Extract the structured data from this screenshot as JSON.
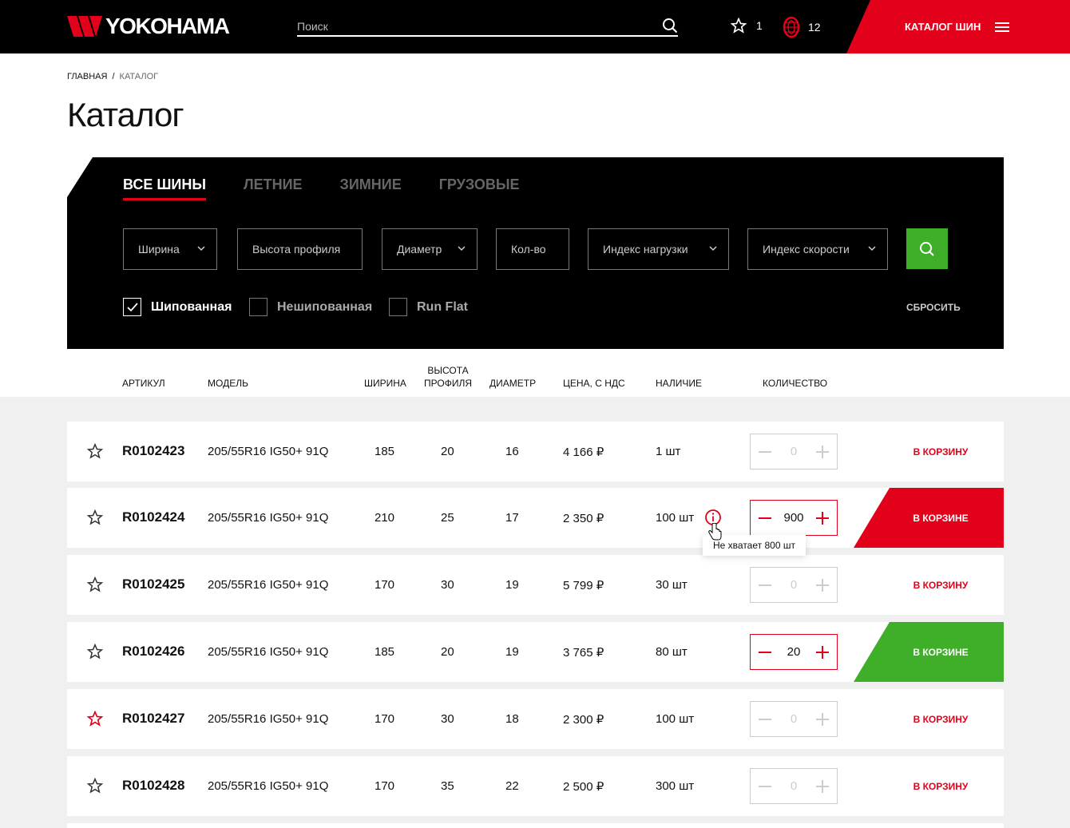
{
  "header": {
    "logo_text": "YOKOHAMA",
    "search_placeholder": "Поиск",
    "favorites_count": "1",
    "tires_count": "12",
    "catalog_label": "КАТАЛОГ ШИН"
  },
  "breadcrumb": {
    "home": "ГЛАВНАЯ",
    "sep": "/",
    "current": "КАТАЛОГ"
  },
  "page_title": "Каталог",
  "tabs": [
    "ВСЕ ШИНЫ",
    "ЛЕТНИЕ",
    "ЗИМНИЕ",
    "ГРУЗОВЫЕ"
  ],
  "filters": {
    "width": "Ширина",
    "profile": "Высота профиля",
    "diameter": "Диаметр",
    "qty": "Кол-во",
    "load_index": "Индекс нагрузки",
    "speed_index": "Индекс скорости"
  },
  "checkboxes": {
    "studded": "Шипованная",
    "non_studded": "Нешипованная",
    "run_flat": "Run Flat"
  },
  "reset_label": "СБРОСИТЬ",
  "columns": {
    "article": "АРТИКУЛ",
    "model": "МОДЕЛЬ",
    "width": "ШИРИНА",
    "profile_1": "ВЫСОТА",
    "profile_2": "ПРОФИЛЯ",
    "diameter": "ДИАМЕТР",
    "price": "ЦЕНА, С НДС",
    "stock": "НАЛИЧИЕ",
    "qty": "КОЛИЧЕСТВО"
  },
  "rows": [
    {
      "article": "R0102423",
      "model": "205/55R16 IG50+ 91Q",
      "width": "185",
      "profile": "20",
      "diameter": "16",
      "price": "4 166 ₽",
      "stock": "1 шт",
      "qty": "0",
      "cart": "В КОРЗИНУ"
    },
    {
      "article": "R0102424",
      "model": "205/55R16 IG50+ 91Q",
      "width": "210",
      "profile": "25",
      "diameter": "17",
      "price": "2 350 ₽",
      "stock": "100 шт",
      "qty": "900",
      "cart": "В КОРЗИНЕ"
    },
    {
      "article": "R0102425",
      "model": "205/55R16 IG50+ 91Q",
      "width": "170",
      "profile": "30",
      "diameter": "19",
      "price": "5 799 ₽",
      "stock": "30 шт",
      "qty": "0",
      "cart": "В КОРЗИНУ"
    },
    {
      "article": "R0102426",
      "model": "205/55R16 IG50+ 91Q",
      "width": "185",
      "profile": "20",
      "diameter": "19",
      "price": "3 765 ₽",
      "stock": "80 шт",
      "qty": "20",
      "cart": "В КОРЗИНЕ"
    },
    {
      "article": "R0102427",
      "model": "205/55R16 IG50+ 91Q",
      "width": "170",
      "profile": "30",
      "diameter": "18",
      "price": "2 300 ₽",
      "stock": "100 шт",
      "qty": "0",
      "cart": "В КОРЗИНУ"
    },
    {
      "article": "R0102428",
      "model": "205/55R16 IG50+ 91Q",
      "width": "170",
      "profile": "35",
      "diameter": "22",
      "price": "2 500 ₽",
      "stock": "300 шт",
      "qty": "0",
      "cart": "В КОРЗИНУ"
    }
  ],
  "tooltip": "Не хватает 800 шт",
  "colors": {
    "accent": "#e2001a",
    "success": "#3fae29",
    "header_bg": "#000000"
  }
}
